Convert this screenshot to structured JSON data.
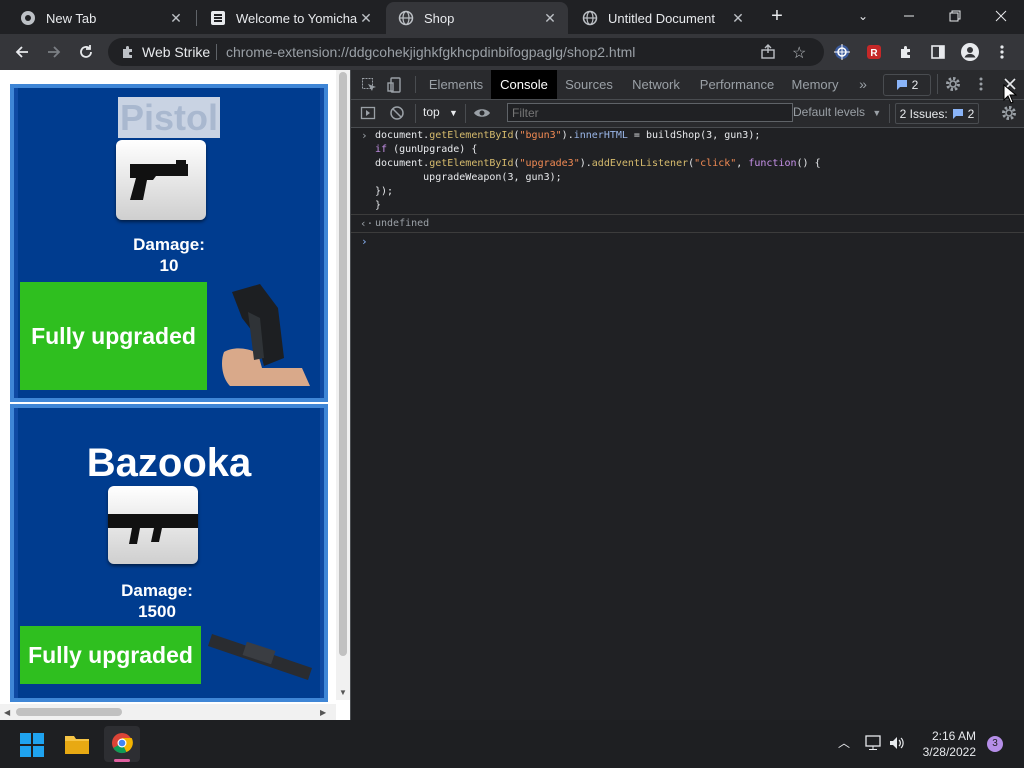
{
  "tabs": [
    {
      "title": "New Tab",
      "icon": "chrome-icon",
      "active": false
    },
    {
      "title": "Welcome to Yomichan!",
      "icon": "yomichan-icon",
      "active": false
    },
    {
      "title": "Shop",
      "icon": "globe-icon",
      "active": true
    },
    {
      "title": "Untitled Document",
      "icon": "globe-icon",
      "active": false
    }
  ],
  "toolbar": {
    "site_label": "Web Strike",
    "url": "chrome-extension://ddgcohekjighkfgkhcpdinbifogpaglg/shop2.html"
  },
  "shop": {
    "items": [
      {
        "name": "Pistol",
        "damage_label": "Damage:",
        "damage": "10",
        "button": "Fully upgraded"
      },
      {
        "name": "Bazooka",
        "damage_label": "Damage:",
        "damage": "1500",
        "button": "Fully upgraded"
      }
    ]
  },
  "devtools": {
    "tabs": [
      "Elements",
      "Console",
      "Sources",
      "Network",
      "Performance",
      "Memory"
    ],
    "active_tab": "Console",
    "message_count": "2",
    "context": "top",
    "filter_placeholder": "Filter",
    "levels": "Default levels",
    "issues": "2 Issues:",
    "issues_count": "2",
    "result": "undefined"
  },
  "taskbar": {
    "time": "2:16 AM",
    "date": "3/28/2022",
    "notifications": "3"
  },
  "colors": {
    "shop_bg": "#003c8f",
    "upgrade_green": "#2fbf1f",
    "devtools_bg": "#202124"
  }
}
